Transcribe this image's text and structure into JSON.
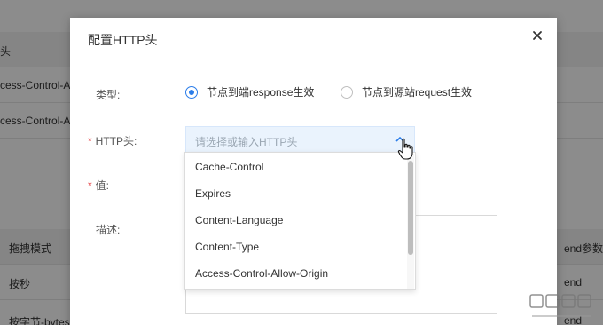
{
  "background": {
    "header_cell": "头",
    "rows": [
      "ccess-Control-Allow",
      "ccess-Control-Allow"
    ],
    "table2": {
      "header_left": "拖拽模式",
      "header_right": "end参数",
      "row1_left": "按秒",
      "row1_right": "end",
      "row2_left": "按字节-bytes",
      "row2_right": "end"
    }
  },
  "dialog": {
    "title": "配置HTTP头",
    "type_label": "类型:",
    "radio_options": [
      {
        "label": "节点到端response生效",
        "checked": true
      },
      {
        "label": "节点到源站request生效",
        "checked": false
      }
    ],
    "http_header_label": "HTTP头:",
    "select_placeholder": "请选择或输入HTTP头",
    "dropdown_options": [
      "Cache-Control",
      "Expires",
      "Content-Language",
      "Content-Type",
      "Access-Control-Allow-Origin"
    ],
    "value_label": "值:",
    "desc_label": "描述:",
    "required_mark": "*"
  },
  "colors": {
    "accent": "#2b7de9",
    "required": "#e4393c",
    "select_bg": "#eaf3fd"
  },
  "icons": {
    "close": "close-icon",
    "chevron": "chevron-up-icon",
    "cursor": "hand-pointer-icon"
  }
}
